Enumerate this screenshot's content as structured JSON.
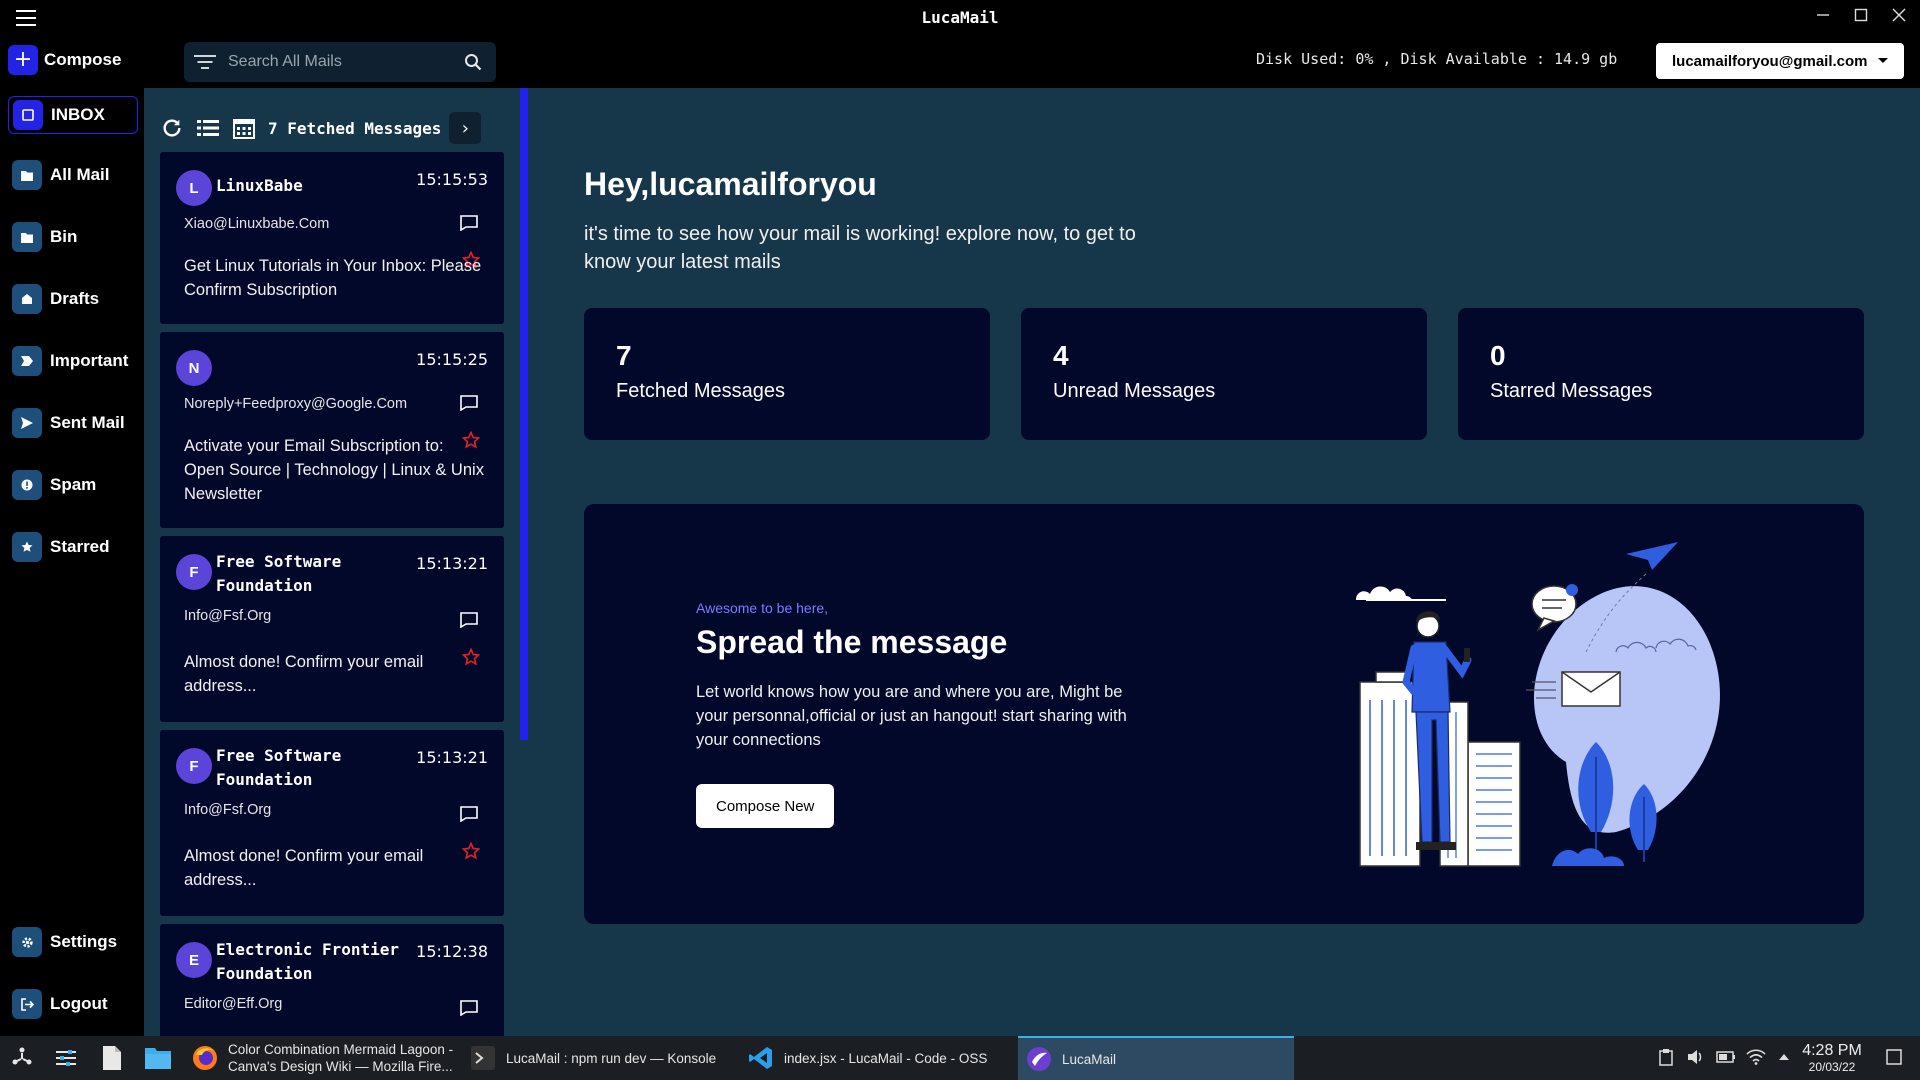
{
  "window": {
    "title": "LucaMail",
    "controls": [
      "minimize-icon",
      "maximize-icon",
      "close-icon"
    ]
  },
  "topbar": {
    "compose_label": "Compose",
    "search_placeholder": "Search All Mails",
    "disk_status": "Disk Used: 0% , Disk Available : 14.9 gb",
    "account": "lucamailforyou@gmail.com"
  },
  "sidebar": {
    "items": [
      {
        "label": "INBOX",
        "icon": "inbox-icon"
      },
      {
        "label": "All Mail",
        "icon": "folder-icon"
      },
      {
        "label": "Bin",
        "icon": "folder-icon"
      },
      {
        "label": "Drafts",
        "icon": "drafts-icon"
      },
      {
        "label": "Important",
        "icon": "important-icon"
      },
      {
        "label": "Sent Mail",
        "icon": "send-icon"
      },
      {
        "label": "Spam",
        "icon": "spam-icon"
      },
      {
        "label": "Starred",
        "icon": "star-icon"
      }
    ],
    "bottom": [
      {
        "label": "Settings",
        "icon": "gear-icon"
      },
      {
        "label": "Logout",
        "icon": "logout-icon"
      }
    ]
  },
  "list": {
    "fetched_label": "7 Fetched Messages",
    "messages": [
      {
        "initial": "L",
        "sender": "LinuxBabe",
        "time": "15:15:53",
        "email": "Xiao@Linuxbabe.Com",
        "subject": "Get Linux Tutorials in Your Inbox: Please Confirm Subscription"
      },
      {
        "initial": "N",
        "sender": "",
        "time": "15:15:25",
        "email": "Noreply+Feedproxy@Google.Com",
        "subject": "Activate your Email Subscription to: Open Source | Technology | Linux & Unix Newsletter"
      },
      {
        "initial": "F",
        "sender": "Free Software Foundation",
        "time": "15:13:21",
        "email": "Info@Fsf.Org",
        "subject": "Almost done! Confirm your email address..."
      },
      {
        "initial": "F",
        "sender": "Free Software Foundation",
        "time": "15:13:21",
        "email": "Info@Fsf.Org",
        "subject": "Almost done! Confirm your email address..."
      },
      {
        "initial": "E",
        "sender": "Electronic Frontier Foundation",
        "time": "15:12:38",
        "email": "Editor@Eff.Org",
        "subject": ""
      }
    ]
  },
  "dashboard": {
    "greeting": "Hey,lucamailforyou",
    "subtitle": "it's time to see how your mail is working! explore now, to get to know your latest mails",
    "stats": [
      {
        "value": "7",
        "label": "Fetched Messages"
      },
      {
        "value": "4",
        "label": "Unread Messages"
      },
      {
        "value": "0",
        "label": "Starred Messages"
      }
    ],
    "promo": {
      "kicker": "Awesome to be here,",
      "title": "Spread the message",
      "text": "Let world knows how you are and where you are, Might be your personnal,official or just an hangout! start sharing with your connections",
      "button": "Compose New"
    }
  },
  "taskbar": {
    "tasks": [
      {
        "label": "Color Combination Mermaid Lagoon - Canva's Design Wiki — Mozilla Fire...",
        "icon": "firefox-icon"
      },
      {
        "label": "LucaMail : npm run dev — Konsole",
        "icon": "terminal-icon"
      },
      {
        "label": "index.jsx - LucaMail - Code - OSS",
        "icon": "vscode-icon"
      },
      {
        "label": "LucaMail",
        "icon": "lucamail-icon"
      }
    ],
    "time": "4:28 PM",
    "date": "20/03/22"
  },
  "colors": {
    "accent": "#2323e6",
    "background": "#16364a",
    "card": "#02082a",
    "avatar": "#5b44d8",
    "star": "#e0202a"
  }
}
